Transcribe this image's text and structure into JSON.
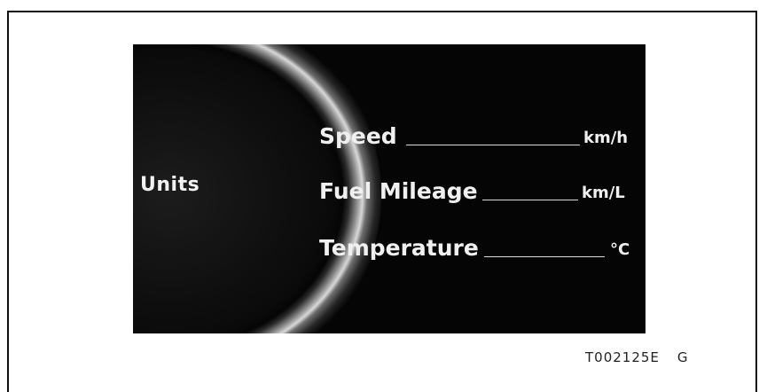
{
  "display": {
    "side_label": "Units",
    "rows": [
      {
        "label": "Speed",
        "unit": "km/h"
      },
      {
        "label": "Fuel Mileage",
        "unit": "km/L"
      },
      {
        "label": "Temperature",
        "unit": "°C"
      }
    ]
  },
  "caption": {
    "figure_code": "T002125E",
    "suffix": "G"
  },
  "colors": {
    "screen_background": "#050505",
    "text": "#f0f0f0",
    "page_background": "#ffffff"
  }
}
